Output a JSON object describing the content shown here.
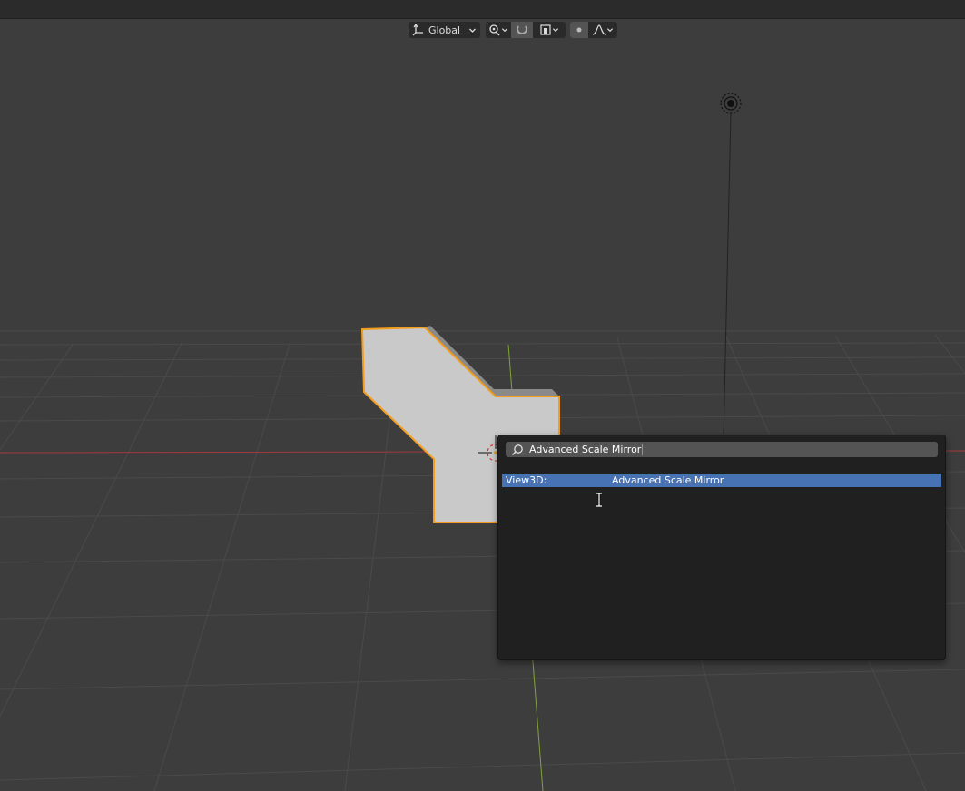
{
  "header": {
    "transform_orientation": "Global"
  },
  "search": {
    "query": "Advanced Scale Mirror",
    "results": [
      {
        "context": "View3D:",
        "label": "Advanced Scale Mirror",
        "highlighted": true
      }
    ]
  },
  "icons": {
    "orientation": "gizmo-axes-icon",
    "pivot": "pivot-link-icon",
    "snap": "magnet-snap-icon",
    "snap_target": "snap-increment-icon",
    "proportional": "proportional-edit-icon",
    "falloff": "falloff-curve-icon",
    "search": "search-icon",
    "light": "light-lamp-icon"
  },
  "colors": {
    "viewport_bg": "#3d3d3d",
    "selection_outline": "#f29d1d",
    "highlight": "#4772b3",
    "x_axis": "#a33a3a",
    "y_axis": "#7fa33a"
  }
}
